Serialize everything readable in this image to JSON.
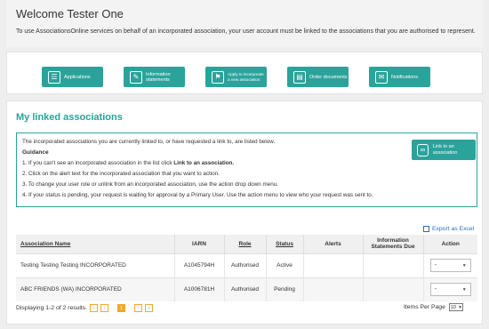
{
  "header": {
    "welcome": "Welcome Tester One",
    "intro": "To use AssociationsOnline services on behalf of an incorporated association, your user account must be linked to the associations that you are authorised to represent."
  },
  "tiles": [
    {
      "label": "Applications",
      "icon": "applications-icon"
    },
    {
      "label": "Information statements",
      "icon": "information-statements-icon"
    },
    {
      "label": "Apply to incorporate a new association",
      "icon": "incorporate-icon"
    },
    {
      "label": "Order documents",
      "icon": "order-documents-icon"
    },
    {
      "label": "Notifications",
      "icon": "notifications-icon"
    }
  ],
  "linked": {
    "title": "My linked associations",
    "intro": "The incorporated associations you are currently linked to, or have requested a link to, are listed below.",
    "guidance_heading": "Guidance",
    "guidance": [
      {
        "pre": "1. If you can't see an incorporated association in the list click ",
        "bold": "Link to an association."
      },
      {
        "pre": "2. Click on the alert text for the incorporated association that you want to action.",
        "bold": ""
      },
      {
        "pre": "3. To change your user role or unlink from an incorporated association, use the action drop down menu.",
        "bold": ""
      },
      {
        "pre": "4. If your status is pending, your request is waiting for approval by a Primary User. Use the action menu to view who your request was sent to.",
        "bold": ""
      }
    ],
    "link_button": "Link to an association"
  },
  "table": {
    "export": "Export as Excel",
    "headers": [
      "Association Name",
      "IARN",
      "Role",
      "Status",
      "Alerts",
      "Information Statements Due",
      "Action"
    ],
    "rows": [
      {
        "name": "Testing Testing Testing INCORPORATED",
        "iarn": "A1045794H",
        "role": "Authorised",
        "status": "Active",
        "alerts": "",
        "due": "",
        "action": "-"
      },
      {
        "name": "ABC FRIENDS (WA) INCORPORATED",
        "iarn": "A1006781H",
        "role": "Authorised",
        "status": "Pending",
        "alerts": "",
        "due": "",
        "action": "-"
      }
    ]
  },
  "pager": {
    "displaying": "Displaying 1-2 of 2 results.",
    "current_page": "1",
    "items_per_page_label": "Items Per Page",
    "items_per_page": "10"
  },
  "colors": {
    "accent": "#2aa39b",
    "active": "#2e8b2e",
    "pending": "#e8a21a",
    "link": "#2a6fb5"
  }
}
